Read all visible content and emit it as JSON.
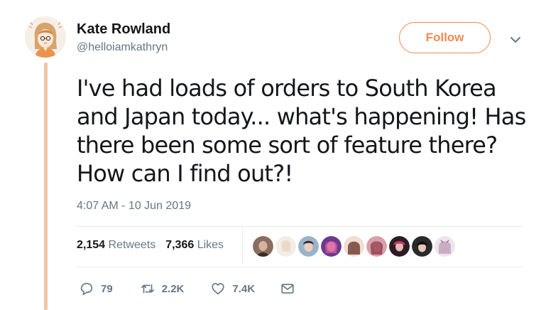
{
  "author": {
    "name": "Kate Rowland",
    "handle": "@helloiamkathryn"
  },
  "follow_label": "Follow",
  "tweet": {
    "lines": [
      "I've had loads of orders to South Korea",
      "and Japan today... what's happening! Has",
      "there been some sort of feature there?",
      "How can I find out?!"
    ],
    "timestamp": "4:07 AM - 10 Jun 2019"
  },
  "stats": {
    "retweets_count": "2,154",
    "retweets_label": "Retweets",
    "likes_count": "7,366",
    "likes_label": "Likes"
  },
  "actions": {
    "replies": "79",
    "retweets": "2.2K",
    "likes": "7.4K"
  },
  "colors": {
    "accent": "#f08a50",
    "thread_line": "#f2c2a6",
    "muted": "#657786"
  },
  "icons": [
    "avatar-illustration",
    "chevron-down-icon",
    "reply-icon",
    "retweet-icon",
    "heart-icon",
    "message-icon"
  ]
}
